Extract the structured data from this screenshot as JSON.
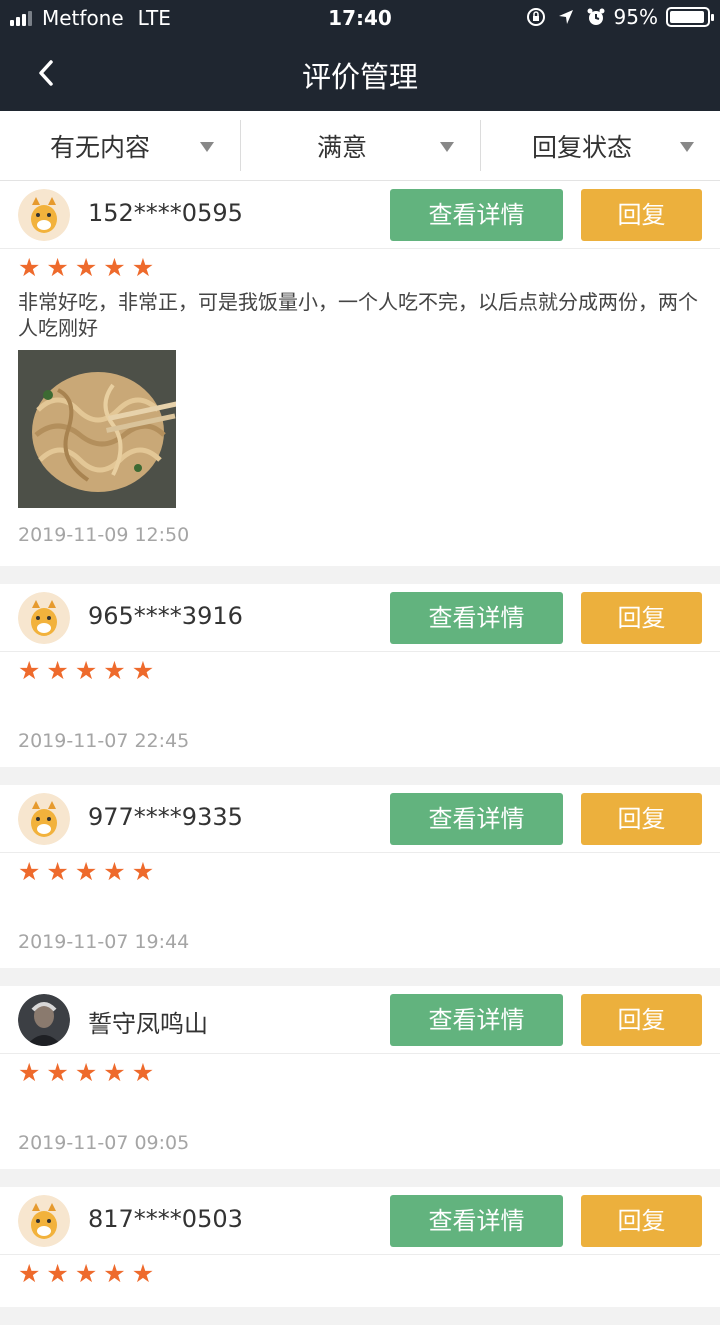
{
  "status_bar": {
    "carrier": "Metfone",
    "network": "LTE",
    "time": "17:40",
    "battery": "95%",
    "battery_level": 0.95
  },
  "nav": {
    "title": "评价管理",
    "back_icon": "chevron-left-icon"
  },
  "filters": [
    {
      "label": "有无内容"
    },
    {
      "label": "满意"
    },
    {
      "label": "回复状态"
    }
  ],
  "reviews": [
    {
      "user": "152****0595",
      "rating": 5,
      "content": "非常好吃，非常正，可是我饭量小，一个人吃不完，以后点就分成两份，两个人吃刚好",
      "date": "2019-11-09 12:50",
      "detail_label": "查看详情",
      "reply_label": "回复"
    },
    {
      "user": "965****3916",
      "rating": 5,
      "content": "",
      "date": "2019-11-07 22:45",
      "detail_label": "查看详情",
      "reply_label": "回复"
    },
    {
      "user": "977****9335",
      "rating": 5,
      "content": "",
      "date": "2019-11-07 19:44",
      "detail_label": "查看详情",
      "reply_label": "回复"
    },
    {
      "user": "誓守凤鸣山",
      "rating": 5,
      "content": "",
      "date": "2019-11-07 09:05",
      "detail_label": "查看详情",
      "reply_label": "回复"
    },
    {
      "user": "817****0503",
      "rating": 5,
      "content": "",
      "date": "",
      "detail_label": "查看详情",
      "reply_label": "回复"
    }
  ]
}
